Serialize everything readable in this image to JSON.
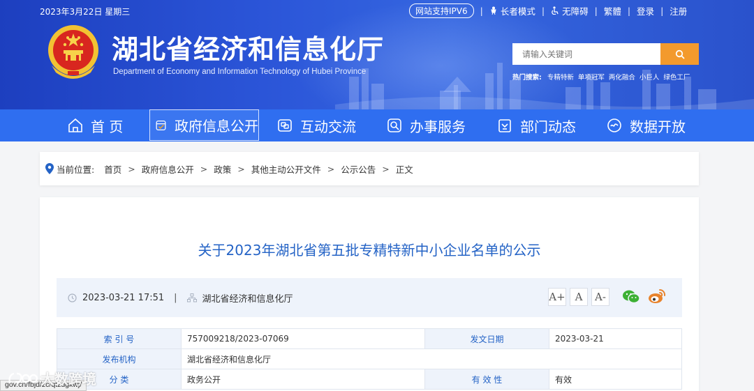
{
  "header": {
    "date": "2023年3月22日 星期三",
    "ipv6": "网站支持IPV6",
    "links": [
      "长者模式",
      "无障碍",
      "繁體",
      "登录",
      "注册"
    ],
    "title": "湖北省经济和信息化厅",
    "subtitle": "Department of Economy and Information Technology of Hubei Province",
    "search_placeholder": "请输入关键词",
    "hot_label": "热门搜索:",
    "hot_terms": [
      "专精特新",
      "单项冠军",
      "两化融合",
      "小巨人",
      "绿色工厂"
    ]
  },
  "nav": {
    "items": [
      "首 页",
      "政府信息公开",
      "互动交流",
      "办事服务",
      "部门动态",
      "数据开放"
    ],
    "active_index": 1
  },
  "breadcrumb": {
    "label": "当前位置:",
    "items": [
      "首页",
      "政府信息公开",
      "政策",
      "其他主动公开文件",
      "公示公告",
      "正文"
    ]
  },
  "article": {
    "title": "关于2023年湖北省第五批专精特新中小企业名单的公示",
    "datetime": "2023-03-21 17:51",
    "source": "湖北省经济和信息化厅",
    "font_sizes": [
      "A+",
      "A",
      "A-"
    ]
  },
  "info_table": {
    "rows": [
      {
        "k1": "索 引 号",
        "v1": "757009218/2023-07069",
        "k2": "发文日期",
        "v2": "2023-03-21"
      },
      {
        "k1": "发布机构",
        "v1": "湖北省经济和信息化厅"
      },
      {
        "k1": "分    类",
        "v1": "政务公开",
        "k2": "有 效 性",
        "v2": "有效"
      }
    ]
  },
  "status_url": "gov.cn/fbjd/zc/qtzdgkwj/",
  "watermark": "大数跨境",
  "colors": {
    "header_blue": "#2b55d8",
    "nav_blue": "#2f6ef0",
    "search_orange": "#f39a2d",
    "title_blue": "#2463c6",
    "wechat_green": "#3cb034",
    "weibo_orange": "#e8832c"
  }
}
